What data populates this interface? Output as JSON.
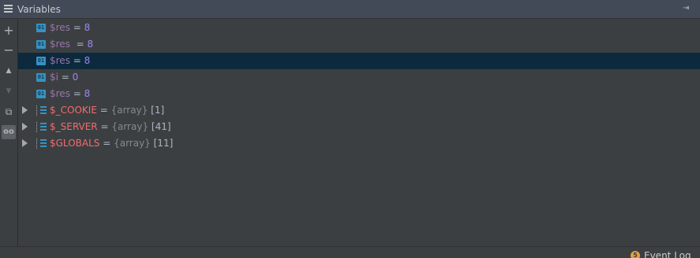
{
  "titlebar": {
    "title": "Variables",
    "menu_icon": "menu-icon",
    "pin_icon": "pin-icon"
  },
  "toolbar": {
    "buttons": [
      {
        "icon": "plus-icon",
        "glyph": "+"
      },
      {
        "icon": "minus-icon",
        "glyph": "−"
      },
      {
        "icon": "arrow-up-icon",
        "glyph": "▲"
      },
      {
        "icon": "arrow-down-icon",
        "glyph": "▼"
      },
      {
        "icon": "copy-icon",
        "glyph": "⧉"
      },
      {
        "icon": "glasses-icon",
        "glyph": "oo"
      }
    ]
  },
  "variables": [
    {
      "name": "$res",
      "eq": " = ",
      "value": "8",
      "type": "",
      "count": ""
    },
    {
      "name": "$res",
      "eq": "  = ",
      "value": "8",
      "type": "",
      "count": ""
    },
    {
      "name": "$res",
      "eq": " = ",
      "value": "8",
      "type": "",
      "count": ""
    },
    {
      "name": "$i",
      "eq": " = ",
      "value": "0",
      "type": "",
      "count": ""
    },
    {
      "name": "$res",
      "eq": " = ",
      "value": "8",
      "type": "",
      "count": ""
    },
    {
      "name": "$_COOKIE",
      "eq": " = ",
      "value": "",
      "type": "{array}",
      "count": " [1]"
    },
    {
      "name": "$_SERVER",
      "eq": " = ",
      "value": "",
      "type": "{array}",
      "count": " [41]"
    },
    {
      "name": "$GLOBALS",
      "eq": " = ",
      "value": "",
      "type": "{array}",
      "count": " [11]"
    }
  ],
  "prim_icon_text": "01",
  "statusbar": {
    "event_count": "5",
    "event_label": "Event Log"
  },
  "colors": {
    "selected_row": "#0d293e",
    "special_var": "#f26c6c",
    "value": "#9b87f0"
  }
}
